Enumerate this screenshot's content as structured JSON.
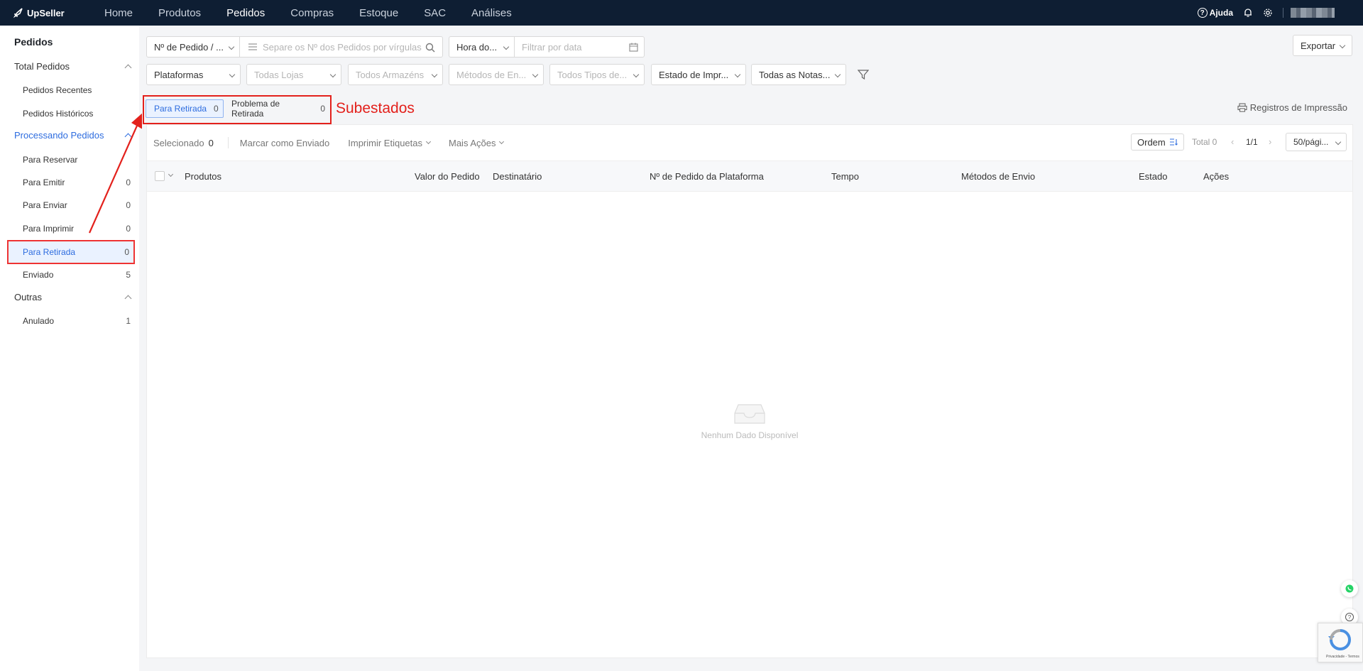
{
  "topnav": {
    "brand": "UpSeller",
    "items": [
      "Home",
      "Produtos",
      "Pedidos",
      "Compras",
      "Estoque",
      "SAC",
      "Análises"
    ],
    "active_item": "Pedidos",
    "help_label": "Ajuda"
  },
  "sidebar": {
    "title": "Pedidos",
    "groups": {
      "total": "Total Pedidos",
      "processing": "Processando Pedidos",
      "other": "Outras"
    },
    "total_items": [
      {
        "label": "Pedidos Recentes"
      },
      {
        "label": "Pedidos Históricos"
      }
    ],
    "processing_items": [
      {
        "label": "Para Reservar",
        "count": ""
      },
      {
        "label": "Para Emitir",
        "count": "0"
      },
      {
        "label": "Para Enviar",
        "count": "0"
      },
      {
        "label": "Para Imprimir",
        "count": "0"
      },
      {
        "label": "Para Retirada",
        "count": "0"
      },
      {
        "label": "Enviado",
        "count": "5"
      }
    ],
    "other_items": [
      {
        "label": "Anulado",
        "count": "1"
      }
    ]
  },
  "filters": {
    "search_type": "Nº de Pedido / ...",
    "search_placeholder": "Separe os Nº dos Pedidos por vírgulas",
    "time_type": "Hora do...",
    "date_placeholder": "Filtrar por data",
    "export_label": "Exportar",
    "platforms": "Plataformas",
    "stores": "Todas Lojas",
    "warehouses": "Todos Armazéns",
    "shipping_methods": "Métodos de En...",
    "types": "Todos Tipos de...",
    "print_status": "Estado de Impr...",
    "notes": "Todas as Notas..."
  },
  "substatus_tabs": [
    {
      "label": "Para Retirada",
      "count": "0",
      "active": true
    },
    {
      "label": "Problema de Retirada",
      "count": "0",
      "active": false
    }
  ],
  "annotation_label": "Subestados",
  "print_records": "Registros de Impressão",
  "action_bar": {
    "selected_label": "Selecionado",
    "selected_count": "0",
    "mark_shipped": "Marcar como Enviado",
    "print_labels": "Imprimir Etiquetas",
    "more_actions": "Mais Ações",
    "sort_label": "Ordem",
    "total_label": "Total 0",
    "page": "1/1",
    "page_size": "50/pági..."
  },
  "table": {
    "columns": [
      "Produtos",
      "Valor do Pedido",
      "Destinatário",
      "Nº de Pedido da Plataforma",
      "Tempo",
      "Métodos de Envio",
      "Estado",
      "Ações"
    ]
  },
  "empty_text": "Nenhum Dado Disponível",
  "recaptcha_text": "Privacidade - Termos",
  "colors": {
    "accent": "#2d6cdf",
    "nav_bg": "#0e1e33",
    "annotation": "#e3211c",
    "whatsapp": "#25d366"
  }
}
